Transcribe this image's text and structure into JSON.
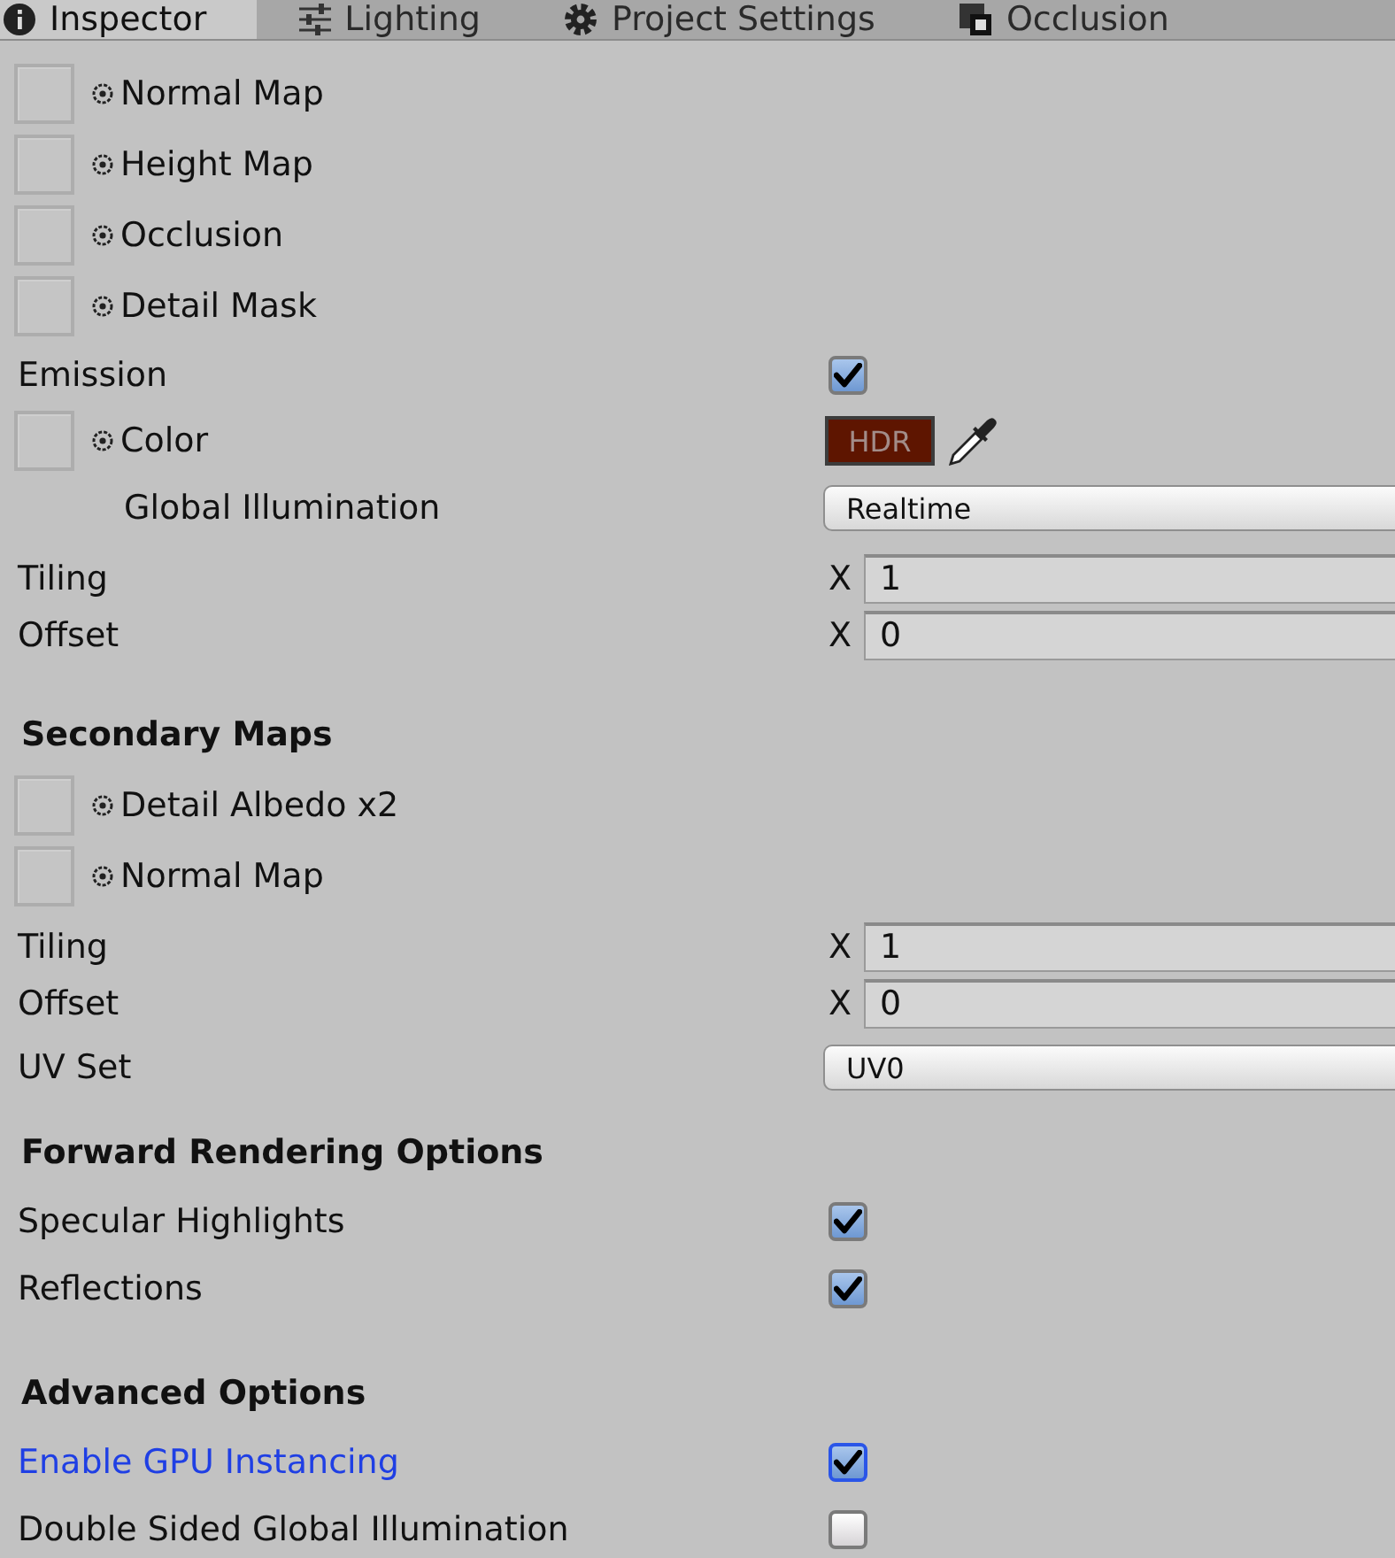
{
  "tabs": [
    {
      "label": "Inspector",
      "selected": true
    },
    {
      "label": "Lighting",
      "selected": false
    },
    {
      "label": "Project Settings",
      "selected": false
    },
    {
      "label": "Occlusion",
      "selected": false
    }
  ],
  "sections": [
    {
      "rows": [
        {
          "kind": "texture",
          "label": "Normal Map"
        },
        {
          "kind": "texture",
          "label": "Height Map"
        },
        {
          "kind": "texture",
          "label": "Occlusion"
        },
        {
          "kind": "texture",
          "label": "Detail Mask"
        },
        {
          "kind": "toggle",
          "label": "Emission",
          "checked": true,
          "focused": false
        },
        {
          "kind": "color",
          "label": "Color",
          "swatch_text": "HDR",
          "color": "#5e1500",
          "children": [
            {
              "kind": "dropdown",
              "label": "Global Illumination",
              "value": "Realtime"
            }
          ]
        },
        {
          "kind": "vector",
          "label": "Tiling",
          "axis": "X",
          "value": "1"
        },
        {
          "kind": "vector",
          "label": "Offset",
          "axis": "X",
          "value": "0"
        }
      ]
    },
    {
      "title": "Secondary Maps",
      "rows": [
        {
          "kind": "texture",
          "label": "Detail Albedo x2"
        },
        {
          "kind": "texture",
          "label": "Normal Map"
        },
        {
          "kind": "vector",
          "label": "Tiling",
          "axis": "X",
          "value": "1"
        },
        {
          "kind": "vector",
          "label": "Offset",
          "axis": "X",
          "value": "0"
        },
        {
          "kind": "dropdown",
          "label": "UV Set",
          "value": "UV0"
        }
      ]
    },
    {
      "title": "Forward Rendering Options",
      "rows": [
        {
          "kind": "toggle",
          "label": "Specular Highlights",
          "checked": true,
          "focused": false
        },
        {
          "kind": "toggle",
          "label": "Reflections",
          "checked": true,
          "focused": false
        }
      ]
    },
    {
      "title": "Advanced Options",
      "rows": [
        {
          "kind": "toggle",
          "label": "Enable GPU Instancing",
          "checked": true,
          "focused": true
        },
        {
          "kind": "toggle",
          "label": "Double Sided Global Illumination",
          "checked": false,
          "focused": false
        }
      ]
    }
  ]
}
